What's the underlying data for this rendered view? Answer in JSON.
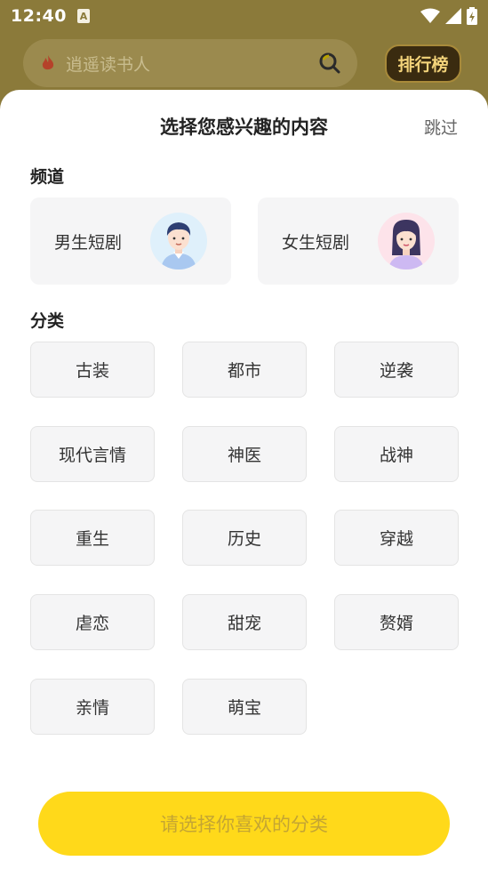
{
  "status_bar": {
    "time": "12:40",
    "notification_icon": "A"
  },
  "background": {
    "search_placeholder": "逍遥读书人",
    "rank_label": "排行榜"
  },
  "sheet": {
    "title": "选择您感兴趣的内容",
    "skip_label": "跳过",
    "channel_section_label": "频道",
    "channels": [
      {
        "label": "男生短剧",
        "icon": "male-avatar-icon"
      },
      {
        "label": "女生短剧",
        "icon": "female-avatar-icon"
      }
    ],
    "category_section_label": "分类",
    "categories": [
      "古装",
      "都市",
      "逆袭",
      "现代言情",
      "神医",
      "战神",
      "重生",
      "历史",
      "穿越",
      "虐恋",
      "甜宠",
      "赘婿",
      "亲情",
      "萌宝"
    ],
    "confirm_label": "请选择你喜欢的分类"
  },
  "colors": {
    "accent": "#ffd91a",
    "confirm_text": "#c4a533",
    "card_bg": "#f5f5f6",
    "overlay_bg": "#8b7a3a"
  }
}
